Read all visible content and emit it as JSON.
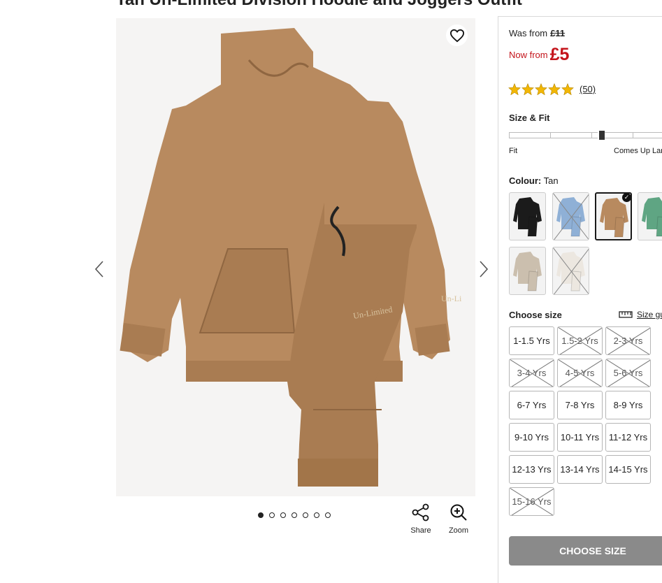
{
  "product": {
    "title": "Tan Un-Limited Division Hoodie and Joggers Outfit",
    "gallery_total": 7,
    "gallery_active": 1,
    "tools": {
      "share_label": "Share",
      "zoom_label": "Zoom"
    }
  },
  "pricing": {
    "was_label": "Was from",
    "was_price": "£11",
    "now_label": "Now from",
    "now_price": "£5",
    "rating_value": 5,
    "review_count": "(50)"
  },
  "fit": {
    "title": "Size & Fit",
    "left_label": "Fit",
    "right_label": "Comes Up Large"
  },
  "colour": {
    "label": "Colour:",
    "selected": "Tan",
    "swatches": [
      {
        "name": "Black",
        "hex": "#1b1b1b",
        "available": true,
        "selected": false
      },
      {
        "name": "Blue",
        "hex": "#8fb0d6",
        "available": false,
        "selected": false
      },
      {
        "name": "Tan",
        "hex": "#b88a5f",
        "available": true,
        "selected": true
      },
      {
        "name": "Green",
        "hex": "#5fa583",
        "available": true,
        "selected": false
      },
      {
        "name": "Stone",
        "hex": "#cbbfae",
        "available": true,
        "selected": false
      },
      {
        "name": "Cream",
        "hex": "#ece7e0",
        "available": false,
        "selected": false
      }
    ]
  },
  "sizes": {
    "title": "Choose size",
    "guide_label": "Size guide",
    "options": [
      {
        "label": "1-1.5 Yrs",
        "available": true
      },
      {
        "label": "1.5-2 Yrs",
        "available": false
      },
      {
        "label": "2-3 Yrs",
        "available": false
      },
      {
        "label": "3-4 Yrs",
        "available": false
      },
      {
        "label": "4-5 Yrs",
        "available": false
      },
      {
        "label": "5-6 Yrs",
        "available": false
      },
      {
        "label": "6-7 Yrs",
        "available": true
      },
      {
        "label": "7-8 Yrs",
        "available": true
      },
      {
        "label": "8-9 Yrs",
        "available": true
      },
      {
        "label": "9-10 Yrs",
        "available": true
      },
      {
        "label": "10-11 Yrs",
        "available": true
      },
      {
        "label": "11-12 Yrs",
        "available": true
      },
      {
        "label": "12-13 Yrs",
        "available": true
      },
      {
        "label": "13-14 Yrs",
        "available": true
      },
      {
        "label": "14-15 Yrs",
        "available": true
      },
      {
        "label": "15-16 Yrs",
        "available": false
      }
    ]
  },
  "cta": {
    "label": "CHOOSE SIZE"
  },
  "colors": {
    "sale_red": "#c4141b",
    "star_gold": "#f2b705",
    "tan": "#b88a5f",
    "cta_grey": "#8a8a8a"
  }
}
